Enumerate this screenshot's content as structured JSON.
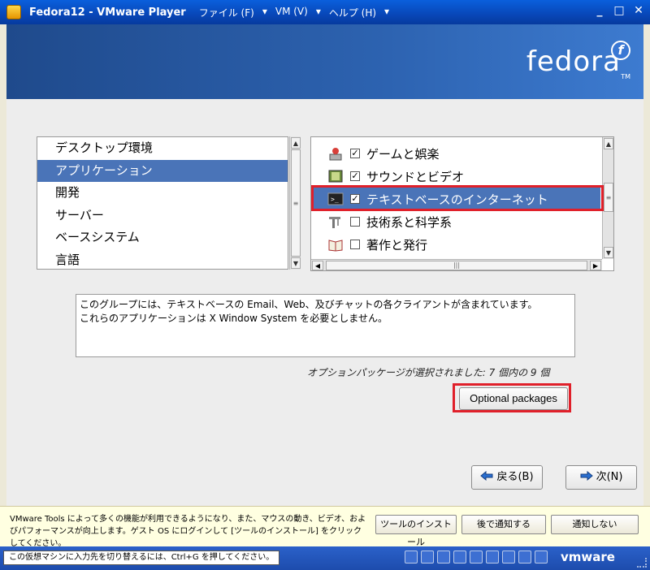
{
  "window": {
    "title": "Fedora12 - VMware Player",
    "menu": [
      "ファイル (F)",
      "VM (V)",
      "ヘルプ (H)"
    ],
    "controls": [
      "_",
      "□",
      "✕"
    ]
  },
  "banner": {
    "logo_text": "fedora",
    "logo_mark": "f",
    "trademark": "TM"
  },
  "category_list": {
    "items": [
      "デスクトップ環境",
      "アプリケーション",
      "開発",
      "サーバー",
      "ベースシステム",
      "言語"
    ],
    "selected_index": 1
  },
  "group_list": {
    "items": [
      {
        "label": "ゲームと娯楽",
        "checked": true,
        "icon": "game-icon"
      },
      {
        "label": "サウンドとビデオ",
        "checked": true,
        "icon": "film-icon"
      },
      {
        "label": "テキストベースのインターネット",
        "checked": true,
        "icon": "terminal-icon",
        "selected": true
      },
      {
        "label": "技術系と科学系",
        "checked": false,
        "icon": "tools-icon"
      },
      {
        "label": "著作と発行",
        "checked": false,
        "icon": "book-icon"
      }
    ]
  },
  "description": {
    "line1": "このグループには、テキストベースの Email、Web、及びチャットの各クライアントが含まれています。",
    "line2": "これらのアプリケーションは X Window System を必要としません。"
  },
  "optional_status": "オプションパッケージが選択されました: 7 個内の 9 個",
  "buttons": {
    "optional": "Optional packages",
    "back": "戻る(B)",
    "next": "次(N)"
  },
  "vmware_tools": {
    "message": "VMware Tools によって多くの機能が利用できるようになり、また、マウスの動き、ビデオ、およびパフォーマンスが向上します。ゲスト OS にログインして [ツールのインストール] をクリックしてください。",
    "install": "ツールのインストール",
    "later": "後で通知する",
    "never": "通知しない"
  },
  "statusbar": {
    "hint": "この仮想マシンに入力先を切り替えるには、Ctrl+G を押してください。",
    "brand": "vmware"
  },
  "colors": {
    "title_bar": "#0847b8",
    "selection": "#4a74b8",
    "highlight": "#e0202a"
  }
}
